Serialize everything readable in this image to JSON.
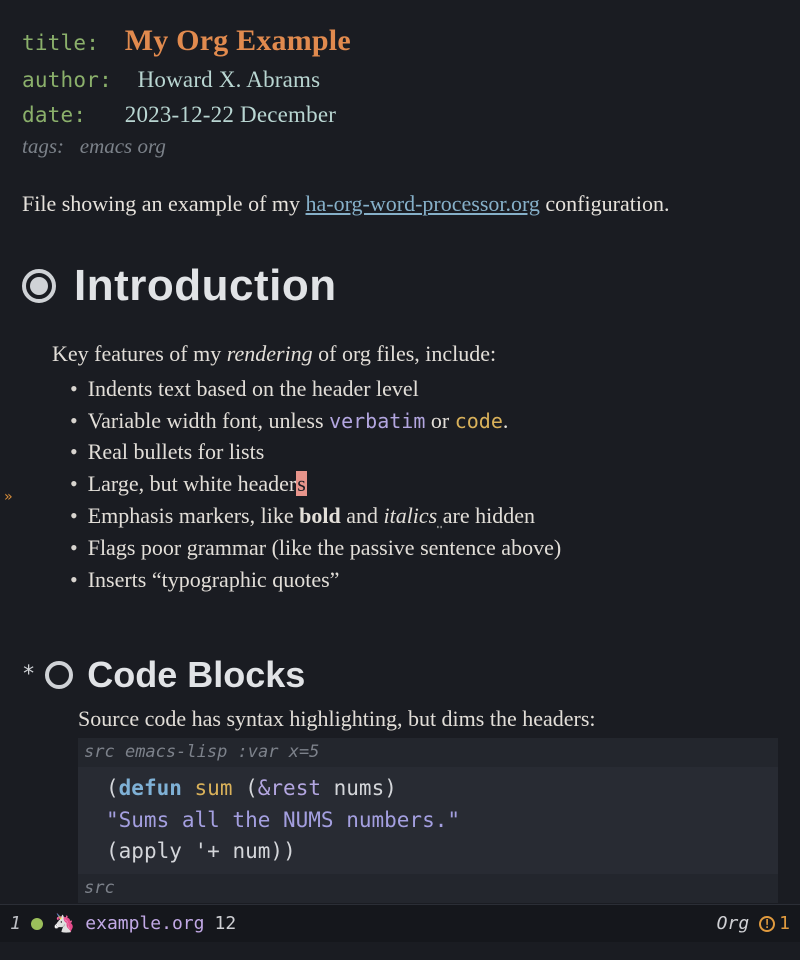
{
  "meta": {
    "title_key": "title",
    "title_val": "My Org Example",
    "author_key": "author",
    "author_val": "Howard X. Abrams",
    "date_key": "date",
    "date_val": "2023-12-22 December",
    "tags_key": "tags:",
    "tags_val": "emacs org"
  },
  "intro": {
    "pre": "File showing an example of my ",
    "link": "ha-org-word-processor.org",
    "post": " configuration."
  },
  "gutter_marker": "»",
  "sections": {
    "intro_heading": "Introduction",
    "code_heading": "Code Blocks",
    "star_prefix": "*"
  },
  "features": {
    "lead_a": "Key features of my ",
    "lead_em": "rendering",
    "lead_b": " of org files, include:",
    "items": [
      {
        "text": "Indents text based on the header level"
      },
      {
        "pre": "Variable width font, unless ",
        "verbatim": "verbatim",
        "mid": " or ",
        "code": "code",
        "post": "."
      },
      {
        "text": "Real bullets for lists"
      },
      {
        "pre": "Large, but white header",
        "err": "s"
      },
      {
        "pre": "Emphasis markers, like ",
        "bold": "bold",
        "mid": " and ",
        "italic": "italics",
        "wavy": " ",
        "post": "are hidden"
      },
      {
        "text": "Flags poor grammar (like the passive sentence above)"
      },
      {
        "text": "Inserts “typographic quotes”"
      }
    ]
  },
  "codeblock": {
    "lead": "Source code has syntax highlighting, but dims the headers:",
    "header_src": "src",
    "header_lang": " emacs-lisp :var x=5",
    "line1": {
      "open": "(",
      "kw": "defun",
      "sp1": " ",
      "fn": "sum",
      "sp2": " (",
      "amp": "&rest",
      "sp3": " ",
      "arg": "nums",
      "close": ")"
    },
    "line2": {
      "indent": "  ",
      "str": "\"Sums all the NUMS numbers.\""
    },
    "line3": {
      "indent": "  (",
      "apply": "apply",
      "sp": " '",
      "plus": "+",
      "sp2": " ",
      "num": "num",
      "close": "))"
    },
    "footer": "src"
  },
  "modeline": {
    "winnum": "1",
    "unicorn": "🦄",
    "filename": "example.org",
    "line": "12",
    "mode": "Org",
    "warn_count": "1",
    "warn_glyph": "!"
  }
}
